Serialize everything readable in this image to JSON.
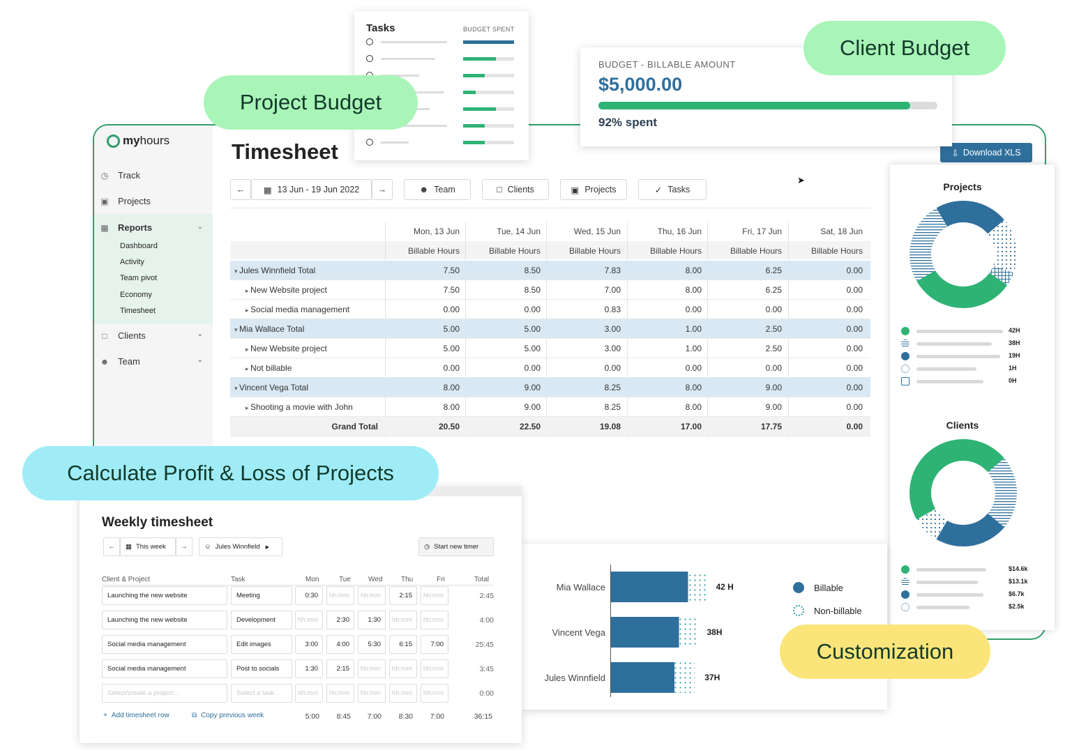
{
  "app": {
    "logo_text_bold": "my",
    "logo_text": "hours",
    "page_title": "Timesheet",
    "download_label": "Download XLS"
  },
  "sidebar": {
    "track": "Track",
    "projects": "Projects",
    "reports": "Reports",
    "report_items": [
      "Dashboard",
      "Activity",
      "Team pivot",
      "Economy",
      "Timesheet"
    ],
    "clients": "Clients",
    "team": "Team"
  },
  "toolbar": {
    "date_range": "13 Jun - 19 Jun 2022",
    "team": "Team",
    "clients": "Clients",
    "projects": "Projects",
    "tasks": "Tasks"
  },
  "timesheet": {
    "days": [
      "Mon, 13 Jun",
      "Tue, 14 Jun",
      "Wed, 15 Jun",
      "Thu, 16 Jun",
      "Fri, 17 Jun",
      "Sat, 18 Jun"
    ],
    "metric": "Billable Hours",
    "rows": [
      {
        "label": "Jules Winnfield Total",
        "kind": "total",
        "values": [
          "7.50",
          "8.50",
          "7.83",
          "8.00",
          "6.25",
          "0.00"
        ]
      },
      {
        "label": "New Website project",
        "kind": "child",
        "values": [
          "7.50",
          "8.50",
          "7.00",
          "8.00",
          "6.25",
          "0.00"
        ]
      },
      {
        "label": "Social media management",
        "kind": "child",
        "values": [
          "0.00",
          "0.00",
          "0.83",
          "0.00",
          "0.00",
          "0.00"
        ]
      },
      {
        "label": "Mia Wallace Total",
        "kind": "total",
        "values": [
          "5.00",
          "5.00",
          "3.00",
          "1.00",
          "2.50",
          "0.00"
        ]
      },
      {
        "label": "New Website project",
        "kind": "child",
        "values": [
          "5.00",
          "5.00",
          "3.00",
          "1.00",
          "2.50",
          "0.00"
        ]
      },
      {
        "label": "Not billable",
        "kind": "child",
        "values": [
          "0.00",
          "0.00",
          "0.00",
          "0.00",
          "0.00",
          "0.00"
        ]
      },
      {
        "label": "Vincent Vega Total",
        "kind": "total",
        "values": [
          "8.00",
          "9.00",
          "8.25",
          "8.00",
          "9.00",
          "0.00"
        ]
      },
      {
        "label": "Shooting a movie with John",
        "kind": "child",
        "values": [
          "8.00",
          "9.00",
          "8.25",
          "8.00",
          "9.00",
          "0.00"
        ]
      },
      {
        "label": "Grand Total",
        "kind": "grand",
        "values": [
          "20.50",
          "22.50",
          "19.08",
          "17.00",
          "17.75",
          "0.00"
        ]
      }
    ]
  },
  "tasks_card": {
    "title": "Tasks",
    "budget_label": "BUDGET SPENT",
    "budget_fractions": [
      1.0,
      0.65,
      0.42,
      0.24,
      0.65,
      0.42,
      0.42
    ]
  },
  "client_budget_card": {
    "label": "BUDGET - BILLABLE AMOUNT",
    "amount": "$5,000.00",
    "spent_fraction": 0.92,
    "spent_text": "92% spent"
  },
  "pills": {
    "project_budget": "Project Budget",
    "client_budget": "Client Budget",
    "profit_loss": "Calculate Profit & Loss of Projects",
    "customization": "Customization"
  },
  "projects_chart": {
    "title": "Projects",
    "legend_values": [
      "42H",
      "38H",
      "19H",
      "1H",
      "0H"
    ]
  },
  "clients_chart": {
    "title": "Clients",
    "legend_values": [
      "$14.6k",
      "$13.1k",
      "$6.7k",
      "$2.5k"
    ]
  },
  "chart_data": {
    "type": "bar",
    "categories": [
      "Mia Wallace",
      "Vincent Vega",
      "Jules Winnfield"
    ],
    "series": [
      {
        "name": "Billable",
        "values": [
          34,
          30,
          28
        ]
      },
      {
        "name": "Non-billable",
        "values": [
          8,
          8,
          9
        ]
      }
    ],
    "total_labels": [
      "42 H",
      "38H",
      "37H"
    ]
  },
  "weekly": {
    "title": "Weekly timesheet",
    "this_week": "This week",
    "user": "Jules Winnfield",
    "start_timer": "Start new timer",
    "headers": {
      "client_project": "Client & Project",
      "task": "Task",
      "total": "Total"
    },
    "days": [
      "Mon",
      "Tue",
      "Wed",
      "Thu",
      "Fri"
    ],
    "placeholder_time": "hh:mm",
    "rows": [
      {
        "project": "Launching the new website",
        "task": "Meeting",
        "times": [
          "0:30",
          "",
          "",
          "2:15",
          ""
        ],
        "total": "2:45"
      },
      {
        "project": "Launching the new website",
        "task": "Development",
        "times": [
          "",
          "2:30",
          "1:30",
          "",
          ""
        ],
        "total": "4:00"
      },
      {
        "project": "Social media management",
        "task": "Edit images",
        "times": [
          "3:00",
          "4:00",
          "5:30",
          "6:15",
          "7:00"
        ],
        "total": "25:45"
      },
      {
        "project": "Social media management",
        "task": "Post to socials",
        "times": [
          "1:30",
          "2:15",
          "",
          "",
          ""
        ],
        "total": "3:45"
      }
    ],
    "new_row": {
      "project_placeholder": "Select/create a project...",
      "task_placeholder": "Select a task...",
      "total": "0:00"
    },
    "add_row": "Add timesheet row",
    "copy_week": "Copy previous week",
    "day_totals": [
      "5:00",
      "8:45",
      "7:00",
      "8:30",
      "7:00"
    ],
    "grand_total": "36:15"
  },
  "colors": {
    "green": "#2eb374",
    "blue": "#2f6f9c",
    "light_blue_row": "#d9e8f3",
    "pill_green": "#a9f5b8",
    "pill_cyan": "#9fecf7",
    "pill_yellow": "#fbe57a"
  }
}
